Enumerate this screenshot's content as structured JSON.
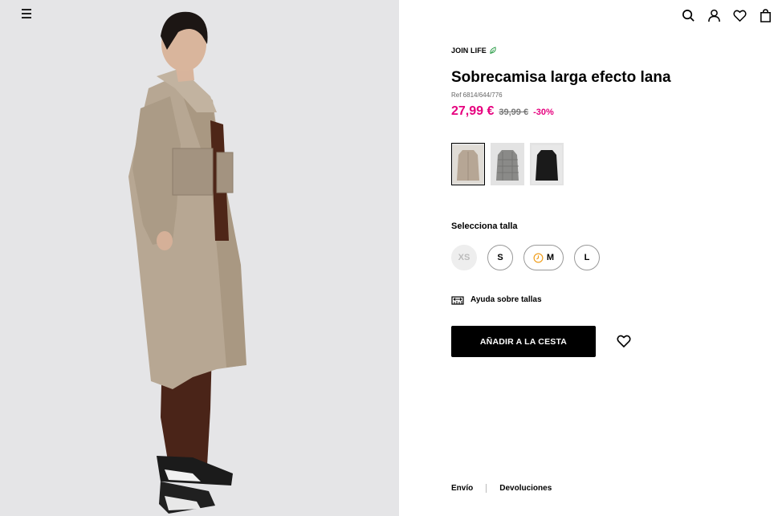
{
  "header": {
    "menu_icon": "hamburger-icon",
    "icons": [
      "search-icon",
      "account-icon",
      "heart-icon",
      "bag-icon"
    ]
  },
  "product": {
    "badge": "JOIN LIFE",
    "title": "Sobrecamisa larga efecto lana",
    "ref": "Ref 6814/644/776",
    "price_now": "27,99 €",
    "price_old": "39,99 €",
    "discount": "-30%",
    "colors": [
      {
        "name": "beige",
        "hex": "#b6a695",
        "active": true
      },
      {
        "name": "grey check",
        "hex": "#8a8a88",
        "active": false
      },
      {
        "name": "black",
        "hex": "#1a1a1a",
        "active": false
      }
    ]
  },
  "sizes": {
    "label": "Selecciona talla",
    "options": [
      {
        "label": "XS",
        "state": "unavailable"
      },
      {
        "label": "S",
        "state": "available"
      },
      {
        "label": "M",
        "state": "coming-soon"
      },
      {
        "label": "L",
        "state": "available"
      }
    ]
  },
  "help": {
    "label": "Ayuda sobre tallas"
  },
  "actions": {
    "add_to_cart": "AÑADIR A LA CESTA"
  },
  "footer": {
    "links": [
      "Envío",
      "Devoluciones"
    ]
  },
  "colors": {
    "accent": "#e6007e",
    "leaf": "#2e9e4a",
    "button_bg": "#000000",
    "image_bg": "#e4e4e6"
  }
}
